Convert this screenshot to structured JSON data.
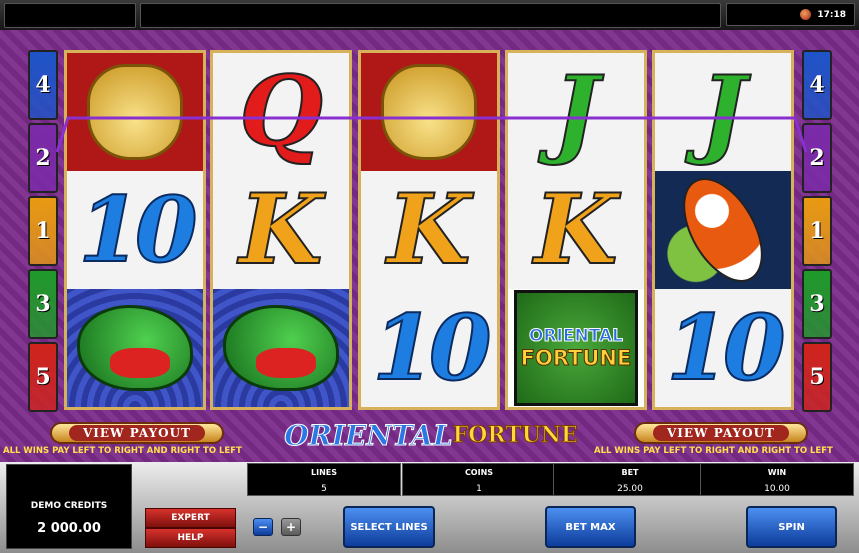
{
  "status_bar": {
    "clock": "17:18",
    "clock_icon": "sound-icon"
  },
  "reels": [
    {
      "symbols": [
        {
          "type": "lion",
          "label": ""
        },
        {
          "type": "ten",
          "label": "10"
        },
        {
          "type": "dragon",
          "label": ""
        }
      ]
    },
    {
      "symbols": [
        {
          "type": "letter",
          "label": "Q",
          "color": "#e21b1b"
        },
        {
          "type": "letter",
          "label": "K",
          "color": "#f0a21a"
        },
        {
          "type": "dragon",
          "label": ""
        }
      ]
    },
    {
      "symbols": [
        {
          "type": "lion",
          "label": ""
        },
        {
          "type": "letter",
          "label": "K",
          "color": "#f0a21a"
        },
        {
          "type": "ten",
          "label": "10"
        }
      ]
    },
    {
      "symbols": [
        {
          "type": "letter",
          "label": "J",
          "color": "#2eb22e"
        },
        {
          "type": "letter",
          "label": "K",
          "color": "#f0a21a"
        },
        {
          "type": "logo",
          "label": "ORIENTAL FORTUNE",
          "line1": "ORIENTAL",
          "line2": "FORTUNE"
        }
      ]
    },
    {
      "symbols": [
        {
          "type": "letter",
          "label": "J",
          "color": "#2eb22e"
        },
        {
          "type": "koi",
          "label": ""
        },
        {
          "type": "ten",
          "label": "10"
        }
      ]
    }
  ],
  "line_indicators": [
    {
      "label": "4",
      "color": "#1e54c8"
    },
    {
      "label": "2",
      "color": "#7b2aa8"
    },
    {
      "label": "1",
      "color": "#e89a12"
    },
    {
      "label": "3",
      "color": "#1f9a2a"
    },
    {
      "label": "5",
      "color": "#d0241c"
    }
  ],
  "game": {
    "view_payout_label": "VIEW PAYOUT",
    "pay_note": "ALL WINS PAY LEFT TO RIGHT AND RIGHT TO LEFT",
    "logo_word1": "ORIENTAL",
    "logo_word2": "FORTUNE"
  },
  "panel": {
    "credits_label": "DEMO CREDITS",
    "credits_value": "2 000.00",
    "expert_label": "EXPERT",
    "help_label": "HELP",
    "minus_label": "−",
    "plus_label": "+",
    "stats": [
      {
        "label": "LINES",
        "value": "5"
      },
      {
        "label": "COINS",
        "value": "1"
      },
      {
        "label": "BET",
        "value": "25.00"
      },
      {
        "label": "WIN",
        "value": "10.00"
      }
    ],
    "select_lines_label": "SELECT LINES",
    "bet_max_label": "BET MAX",
    "spin_label": "SPIN"
  },
  "colors": {
    "frame_purple": "#7a2a8a",
    "reel_border": "#d8b25a",
    "payline": "#8a2fd0"
  }
}
